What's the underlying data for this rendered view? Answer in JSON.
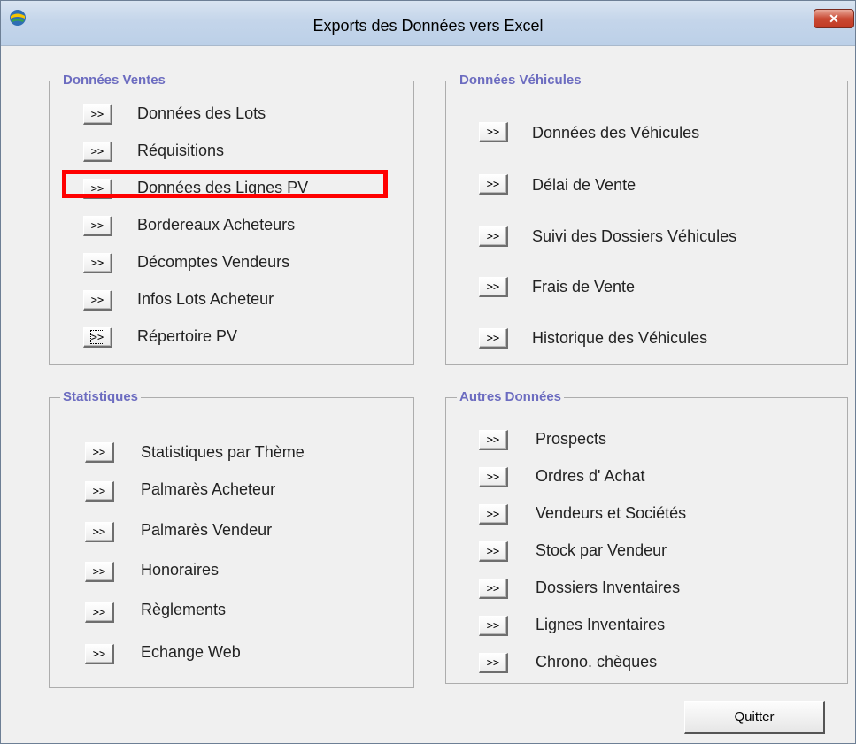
{
  "window": {
    "title": "Exports des Données vers Excel",
    "close_label": "✕"
  },
  "groups": {
    "ventes": {
      "legend": "Données Ventes",
      "items": [
        {
          "button": ">>",
          "label": "Données des Lots"
        },
        {
          "button": ">>",
          "label": "Réquisitions"
        },
        {
          "button": ">>",
          "label": "Données des Lignes PV"
        },
        {
          "button": ">>",
          "label": "Bordereaux Acheteurs"
        },
        {
          "button": ">>",
          "label": "Décomptes Vendeurs"
        },
        {
          "button": ">>",
          "label": "Infos Lots Acheteur"
        },
        {
          "button": ">>",
          "label": "Répertoire PV"
        }
      ]
    },
    "vehicules": {
      "legend": "Données Véhicules",
      "items": [
        {
          "button": ">>",
          "label": "Données des Véhicules"
        },
        {
          "button": ">>",
          "label": "Délai de Vente"
        },
        {
          "button": ">>",
          "label": "Suivi des Dossiers Véhicules"
        },
        {
          "button": ">>",
          "label": "Frais de Vente"
        },
        {
          "button": ">>",
          "label": "Historique des Véhicules"
        }
      ]
    },
    "statistiques": {
      "legend": "Statistiques",
      "items": [
        {
          "button": ">>",
          "label": "Statistiques par Thème"
        },
        {
          "button": ">>",
          "label": "Palmarès Acheteur"
        },
        {
          "button": ">>",
          "label": "Palmarès Vendeur"
        },
        {
          "button": ">>",
          "label": "Honoraires"
        },
        {
          "button": ">>",
          "label": "Règlements"
        },
        {
          "button": ">>",
          "label": "Echange Web"
        }
      ]
    },
    "autres": {
      "legend": "Autres Données",
      "items": [
        {
          "button": ">>",
          "label": "Prospects"
        },
        {
          "button": ">>",
          "label": "Ordres d' Achat"
        },
        {
          "button": ">>",
          "label": "Vendeurs et Sociétés"
        },
        {
          "button": ">>",
          "label": "Stock par Vendeur"
        },
        {
          "button": ">>",
          "label": "Dossiers Inventaires"
        },
        {
          "button": ">>",
          "label": "Lignes Inventaires"
        },
        {
          "button": ">>",
          "label": "Chrono. chèques"
        }
      ]
    }
  },
  "footer": {
    "quit_label": "Quitter"
  },
  "colors": {
    "legend": "#6c6cc0",
    "highlight": "#ff0000"
  }
}
